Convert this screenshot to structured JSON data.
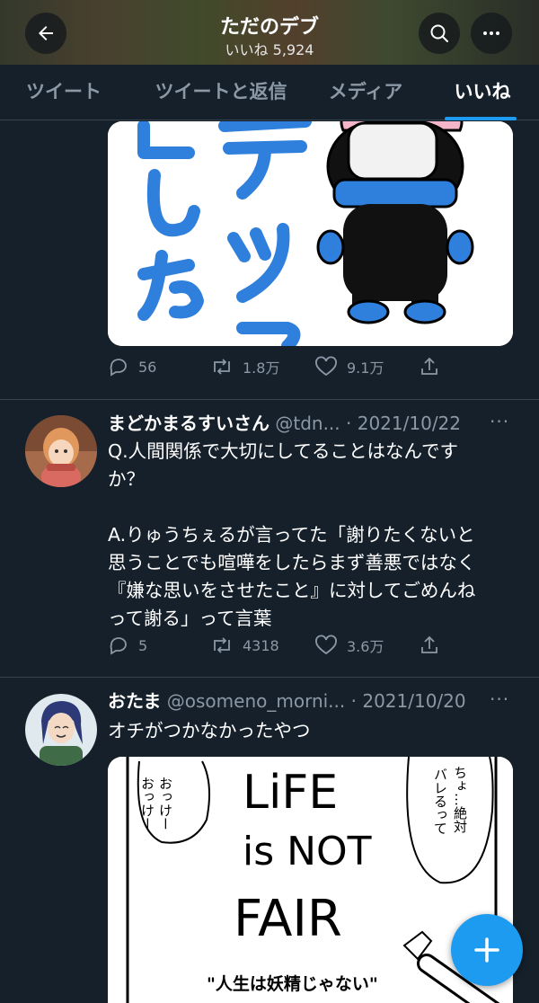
{
  "header": {
    "title": "ただのデブ",
    "subtitle": "いいね 5,924",
    "icons": [
      "back-arrow-icon",
      "search-icon",
      "more-icon"
    ]
  },
  "tabs": [
    {
      "label": "ツイート",
      "active": false
    },
    {
      "label": "ツイートと返信",
      "active": false
    },
    {
      "label": "メディア",
      "active": false
    },
    {
      "label": "いいね",
      "active": true
    }
  ],
  "feed": {
    "tweet0": {
      "image_text": "テック\nした",
      "replies": "56",
      "retweets": "1.8万",
      "likes": "9.1万"
    },
    "tweet1": {
      "name": "まどかまるすいさん",
      "handle": "@tdn...",
      "date": "· 2021/10/22",
      "text": "Q.人間関係で大切にしてることはなんです\nか？\n\nA.りゅうちぇるが言ってた「謝りたくないと\n思うことでも喧嘩をしたらまず善悪ではなく\n『嫌な思いをさせたこと』に対してごめんね\nって謝る」って言葉",
      "replies": "5",
      "retweets": "4318",
      "likes": "3.6万"
    },
    "tweet2": {
      "name": "おたま",
      "handle": "@osomeno_morni...",
      "date": "· 2021/10/20",
      "text": "オチがつかなかったやつ",
      "manga": {
        "bubble_left": "おっけー\nおっけー",
        "bubble_right": "ちょ…絶対\nバレるって",
        "sign_line1": "LiFE",
        "sign_line2": "is NOT",
        "sign_line3": "FAIR",
        "caption": "\"人生は妖精じゃない\""
      }
    }
  },
  "colors": {
    "background": "#15202b",
    "accent": "#1d9bf0",
    "muted": "#8b98a5",
    "divider": "#38444d"
  }
}
